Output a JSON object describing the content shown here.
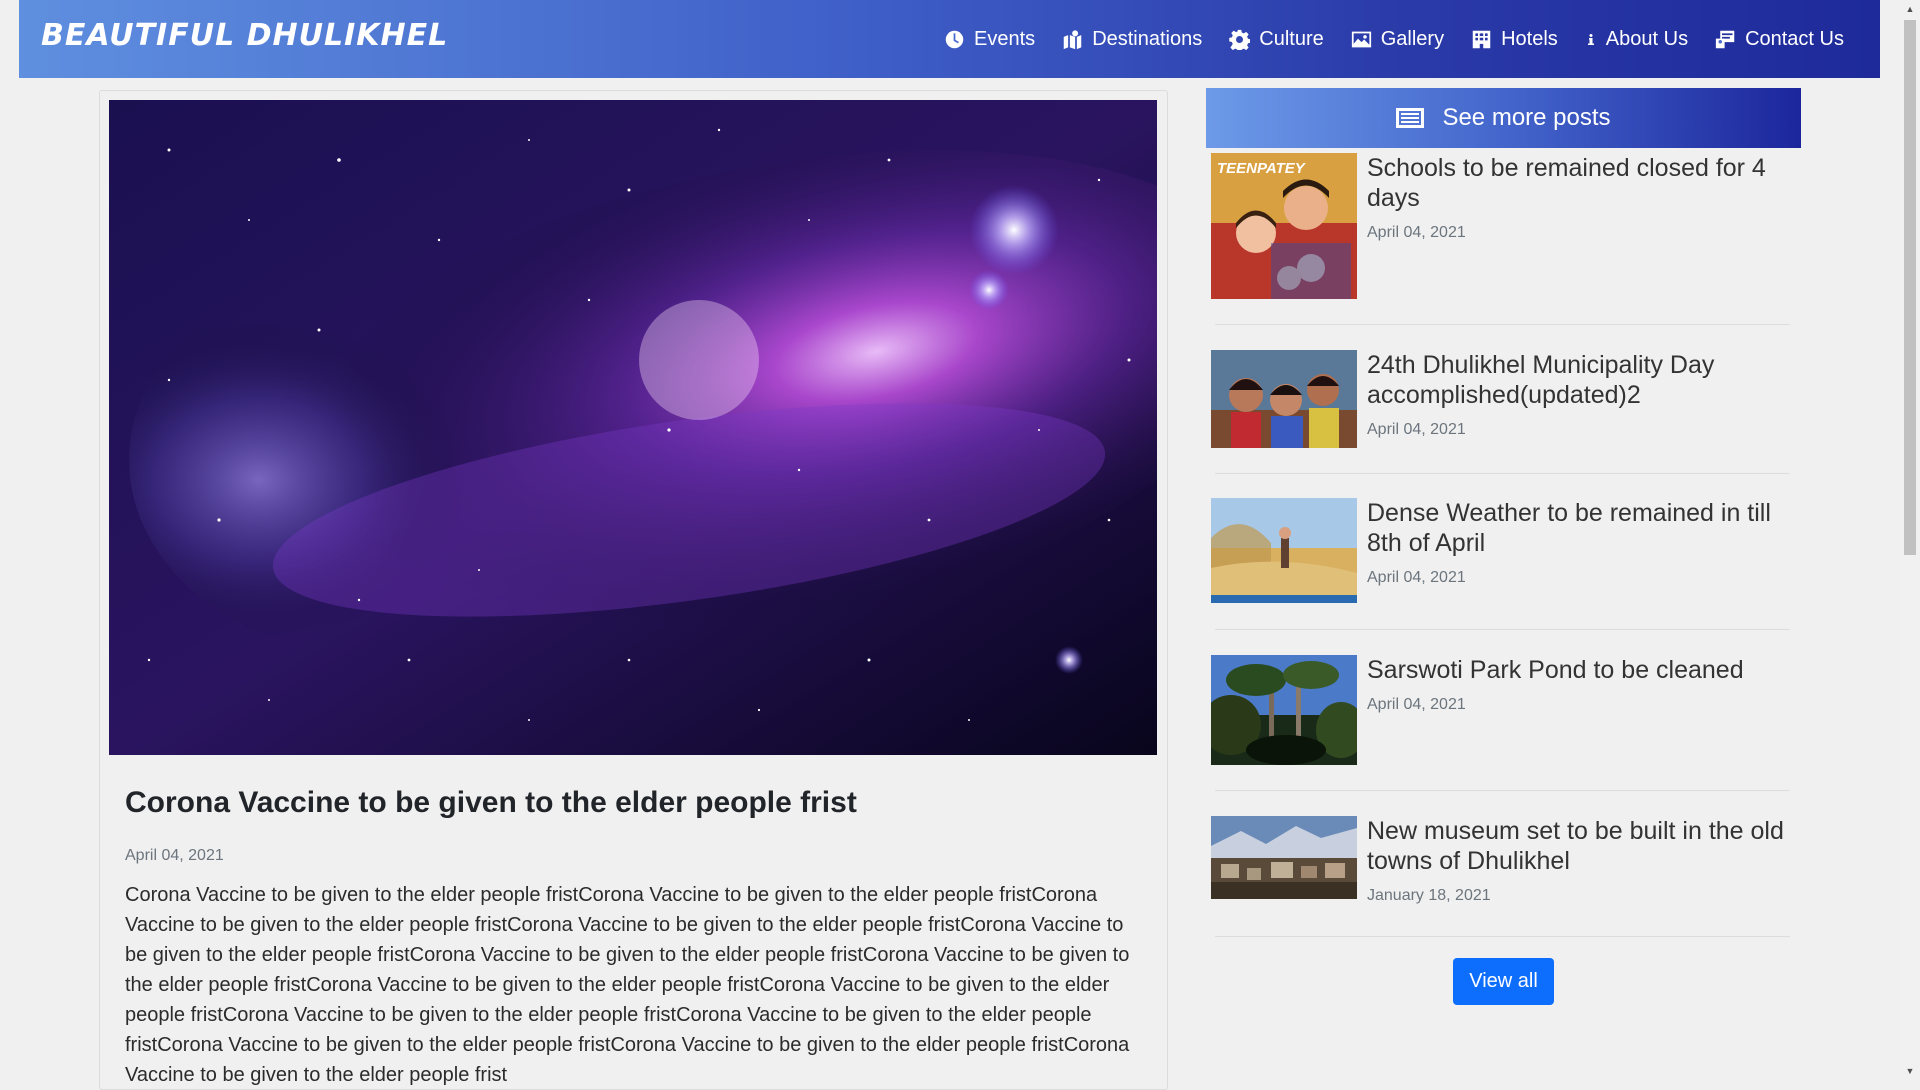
{
  "brand": "BEAUTIFUL DHULIKHEL",
  "nav": [
    {
      "label": "Events",
      "icon": "clock-icon"
    },
    {
      "label": "Destinations",
      "icon": "map-icon"
    },
    {
      "label": "Culture",
      "icon": "gear-icon"
    },
    {
      "label": "Gallery",
      "icon": "image-icon"
    },
    {
      "label": "Hotels",
      "icon": "building-icon"
    },
    {
      "label": "About Us",
      "icon": "info-icon"
    },
    {
      "label": "Contact Us",
      "icon": "contact-card-icon"
    }
  ],
  "main": {
    "title": "Corona Vaccine to be given to the elder people frist",
    "date": "April 04, 2021",
    "body": "Corona Vaccine to be given to the elder people fristCorona Vaccine to be given to the elder people fristCorona Vaccine to be given to the elder people fristCorona Vaccine to be given to the elder people fristCorona Vaccine to be given to the elder people fristCorona Vaccine to be given to the elder people fristCorona Vaccine to be given to the elder people fristCorona Vaccine to be given to the elder people fristCorona Vaccine to be given to the elder people fristCorona Vaccine to be given to the elder people fristCorona Vaccine to be given to the elder people fristCorona Vaccine to be given to the elder people fristCorona Vaccine to be given to the elder people fristCorona Vaccine to be given to the elder people frist"
  },
  "sidebar": {
    "header": "See more posts",
    "posts": [
      {
        "title": "Schools to be remained closed for 4 days",
        "date": "April 04, 2021"
      },
      {
        "title": "24th Dhulikhel Municipality Day accomplished(updated)2",
        "date": "April 04, 2021"
      },
      {
        "title": "Dense Weather to be remained in till 8th of April",
        "date": "April 04, 2021"
      },
      {
        "title": "Sarswoti Park Pond to be cleaned",
        "date": "April 04, 2021"
      },
      {
        "title": "New museum set to be built in the old towns of Dhulikhel",
        "date": "January 18, 2021"
      }
    ],
    "thumb_caption": "TEENPATEY",
    "view_all": "View all"
  },
  "colors": {
    "nav_gradient_start": "#5f8fdf",
    "nav_gradient_end": "#1e2a9a",
    "button_primary": "#0d6efd"
  }
}
